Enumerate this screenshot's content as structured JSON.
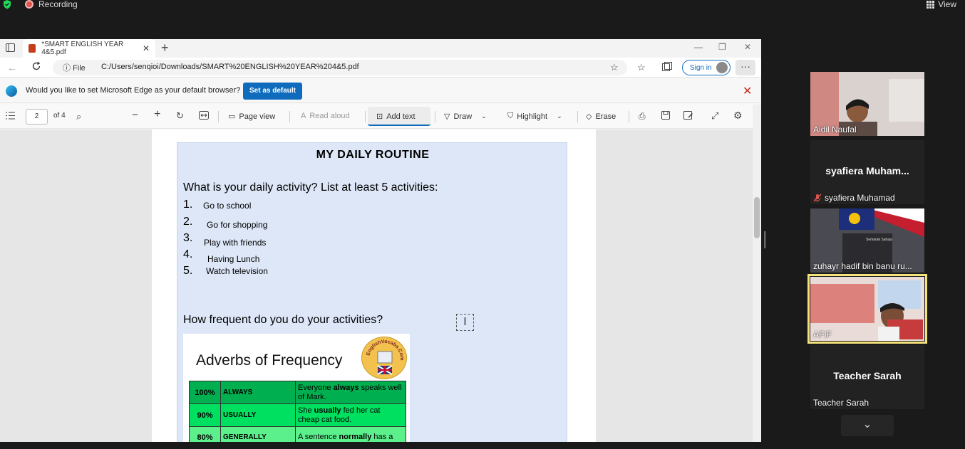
{
  "zoom": {
    "recording_label": "Recording",
    "view_label": "View"
  },
  "browser": {
    "tab_title": "*SMART ENGLISH YEAR 4&5.pdf",
    "address_prefix": "File",
    "address_url": "C:/Users/senqioi/Downloads/SMART%20ENGLISH%20YEAR%204&5.pdf",
    "signin_label": "Sign in",
    "infobar_message": "Would you like to set Microsoft Edge as your default browser?",
    "set_default_label": "Set as default"
  },
  "pdf_toolbar": {
    "page_number": "2",
    "page_total": "of 4",
    "page_view": "Page view",
    "read_aloud": "Read aloud",
    "add_text": "Add text",
    "draw": "Draw",
    "highlight": "Highlight",
    "erase": "Erase"
  },
  "document": {
    "title": "MY DAILY ROUTINE",
    "question1": "What is your daily activity? List at least 5 activities:",
    "activities": [
      {
        "num": "1.",
        "text": "Go to school"
      },
      {
        "num": "2.",
        "text": "Go for shopping"
      },
      {
        "num": "3.",
        "text": "Play with friends"
      },
      {
        "num": "4.",
        "text": "Having Lunch"
      },
      {
        "num": "5.",
        "text": "Watch television"
      }
    ],
    "question2": "How frequent do you do your activities?",
    "adverbs_title": "Adverbs of Frequency",
    "logo_text": "EnglishVocabs.Com",
    "table": [
      {
        "pct": "100%",
        "word": "ALWAYS",
        "ex_pre": "Everyone ",
        "ex_bold": "always",
        "ex_post": " speaks well of Mark."
      },
      {
        "pct": "90%",
        "word": "USUALLY",
        "ex_pre": "She ",
        "ex_bold": "usually",
        "ex_post": " fed her cat cheap cat food."
      },
      {
        "pct": "80%",
        "word": "GENERALLY",
        "ex_pre": "A sentence ",
        "ex_bold": "normally",
        "ex_post": " has a"
      }
    ]
  },
  "participants": [
    {
      "name": "Aidil Naufal",
      "video": true
    },
    {
      "name": "syafiera Muhamad",
      "display": "syafiera  Muham...",
      "muted": true,
      "video": false
    },
    {
      "name": "zuhayr hadif bin banu ru...",
      "video": true
    },
    {
      "name": "AFIF",
      "video": true,
      "active_speaker": true
    },
    {
      "name": "Teacher Sarah",
      "display": "Teacher Sarah",
      "video": false
    }
  ],
  "colors": {
    "accent": "#0f6cbd",
    "doc_panel": "#dde7f7",
    "active_speaker": "#f4e27a",
    "recording": "#e0544e"
  }
}
